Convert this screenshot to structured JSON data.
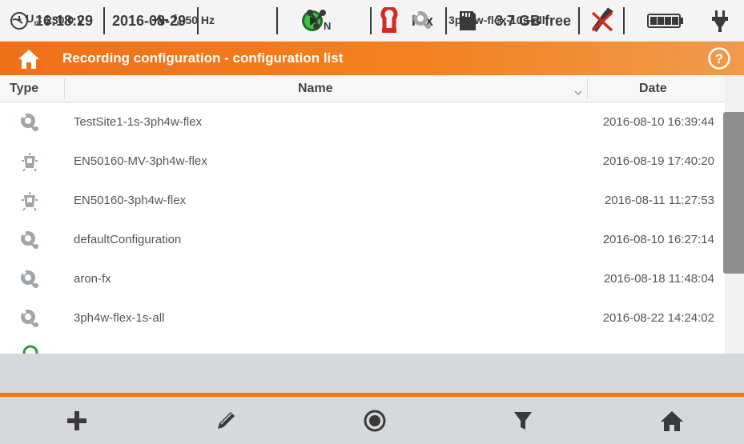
{
  "status": {
    "time": "16:18:29",
    "date": "2016-08-29",
    "clamp_type": "F-x",
    "storage_free": "3.7 GB free"
  },
  "title": "Recording configuration - configuration list",
  "columns": {
    "type": "Type",
    "name": "Name",
    "date": "Date"
  },
  "rows": [
    {
      "icon": "wrench-gear-icon",
      "name": "TestSite1-1s-3ph4w-flex",
      "date": "2016-08-10 16:39:44"
    },
    {
      "icon": "standard-profile-icon",
      "name": "EN50160-MV-3ph4w-flex",
      "date": "2016-08-19 17:40:20"
    },
    {
      "icon": "standard-profile-icon",
      "name": "EN50160-3ph4w-flex",
      "date": "2016-08-11 11:27:53"
    },
    {
      "icon": "wrench-gear-icon",
      "name": "defaultConfiguration",
      "date": "2016-08-10 16:27:14"
    },
    {
      "icon": "wrench-gear-icon",
      "name": "aron-fx",
      "date": "2016-08-18 11:48:04"
    },
    {
      "icon": "wrench-gear-icon",
      "name": "3ph4w-flex-1s-all",
      "date": "2016-08-22 14:24:02"
    }
  ],
  "info": {
    "voltage": "230.0 V",
    "frequency": "50 Hz",
    "active_config": "3ph4w-flex-10s-all"
  },
  "toolbar": [
    "plus-icon",
    "pencil-icon",
    "record-circle-icon",
    "filter-icon",
    "home-icon"
  ],
  "colors": {
    "accent": "#f07a12",
    "icon_gray": "#9aa0a6",
    "active_green": "#2a9d3a"
  }
}
